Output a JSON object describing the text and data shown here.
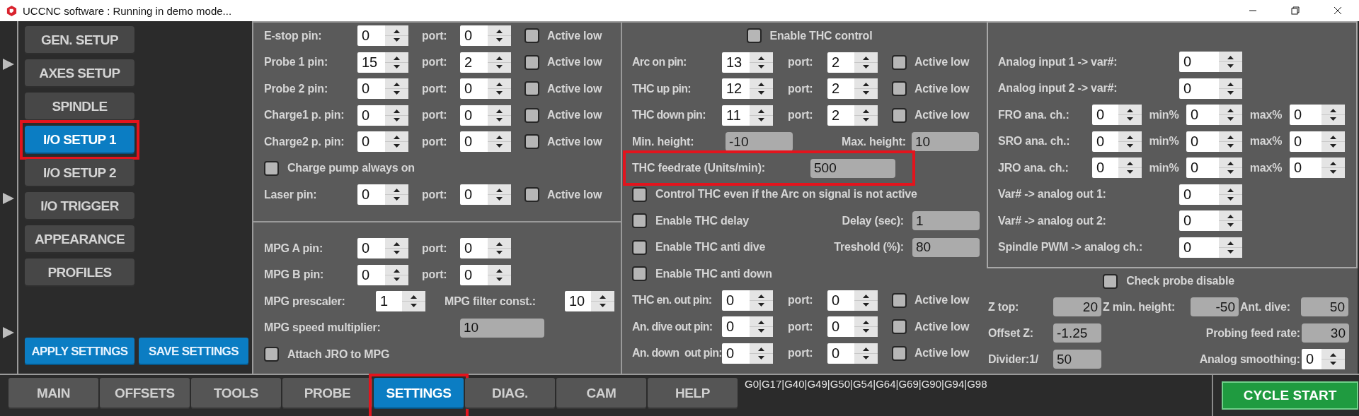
{
  "window": {
    "title": "UCCNC software : Running in demo mode..."
  },
  "sidebar": {
    "items": [
      {
        "label": "GEN. SETUP",
        "selected": false,
        "highlighted": false
      },
      {
        "label": "AXES SETUP",
        "selected": false,
        "highlighted": false
      },
      {
        "label": "SPINDLE",
        "selected": false,
        "highlighted": false
      },
      {
        "label": "I/O SETUP 1",
        "selected": true,
        "highlighted": true
      },
      {
        "label": "I/O SETUP 2",
        "selected": false,
        "highlighted": false
      },
      {
        "label": "I/O TRIGGER",
        "selected": false,
        "highlighted": false
      },
      {
        "label": "APPEARANCE",
        "selected": false,
        "highlighted": false
      },
      {
        "label": "PROFILES",
        "selected": false,
        "highlighted": false
      }
    ],
    "actions": [
      "APPLY SETTINGS",
      "SAVE SETTINGS"
    ]
  },
  "io_panel": {
    "rows": [
      {
        "kind": "pin",
        "label": "E-stop pin:",
        "pin": "0",
        "port_label": "port:",
        "port": "0",
        "option": "Active low",
        "checked": false
      },
      {
        "kind": "pin",
        "label": "Probe 1 pin:",
        "pin": "15",
        "port_label": "port:",
        "port": "2",
        "option": "Active low",
        "checked": false
      },
      {
        "kind": "pin",
        "label": "Probe 2 pin:",
        "pin": "0",
        "port_label": "port:",
        "port": "0",
        "option": "Active low",
        "checked": false
      },
      {
        "kind": "pin",
        "label": "Charge1 p. pin:",
        "pin": "0",
        "port_label": "port:",
        "port": "0",
        "option": "Active low",
        "checked": false
      },
      {
        "kind": "pin",
        "label": "Charge2 p. pin:",
        "pin": "0",
        "port_label": "port:",
        "port": "0",
        "option": "Active low",
        "checked": false
      },
      {
        "kind": "check",
        "label": "Charge pump always on",
        "checked": false
      },
      {
        "kind": "pin",
        "label": "Laser pin:",
        "pin": "0",
        "port_label": "port:",
        "port": "0",
        "option": "Active low",
        "checked": false
      }
    ]
  },
  "mpg_panel": {
    "rows": [
      {
        "kind": "pin",
        "label": "MPG A pin:",
        "pin": "0",
        "port_label": "port:",
        "port": "0"
      },
      {
        "kind": "pin",
        "label": "MPG B pin:",
        "pin": "0",
        "port_label": "port:",
        "port": "0"
      },
      {
        "kind": "spin_pair",
        "label": "MPG prescaler:",
        "value": "1",
        "label2": "MPG filter const.:",
        "value2": "10"
      },
      {
        "kind": "field",
        "label": "MPG speed multiplier:",
        "value": "10"
      },
      {
        "kind": "check",
        "label": "Attach JRO to MPG",
        "checked": false
      }
    ]
  },
  "thc_panel": {
    "rows": [
      {
        "kind": "header_check",
        "label": "Enable THC control",
        "checked": false
      },
      {
        "kind": "pin",
        "label": "Arc on pin:",
        "pin": "13",
        "port_label": "port:",
        "port": "2",
        "option": "Active low",
        "checked": false
      },
      {
        "kind": "pin",
        "label": "THC up pin:",
        "pin": "12",
        "port_label": "port:",
        "port": "2",
        "option": "Active low",
        "checked": false
      },
      {
        "kind": "pin",
        "label": "THC down pin:",
        "pin": "11",
        "port_label": "port:",
        "port": "2",
        "option": "Active low",
        "checked": false
      },
      {
        "kind": "field_pair",
        "label": "Min. height:",
        "value": "-10",
        "label2": "Max. height:",
        "value2": "10"
      },
      {
        "kind": "field",
        "label": "THC feedrate (Units/min):",
        "value": "500",
        "highlighted": true
      },
      {
        "kind": "check",
        "label": "Control THC even if the Arc on signal is not active",
        "checked": false
      },
      {
        "kind": "check_field",
        "label": "Enable THC delay",
        "checked": false,
        "label2": "Delay (sec):",
        "value2": "1"
      },
      {
        "kind": "check_field",
        "label": "Enable THC anti dive",
        "checked": false,
        "label2": "Treshold (%):",
        "value2": "80"
      },
      {
        "kind": "check",
        "label": "Enable THC anti down",
        "checked": false
      },
      {
        "kind": "pin",
        "label": "THC en. out pin:",
        "pin": "0",
        "port_label": "port:",
        "port": "0",
        "option": "Active low",
        "checked": false
      },
      {
        "kind": "pin",
        "label": "An. dive out pin:",
        "pin": "0",
        "port_label": "port:",
        "port": "0",
        "option": "Active low",
        "checked": false
      },
      {
        "kind": "pin",
        "label": "An. down  out pin:",
        "pin": "0",
        "port_label": "port:",
        "port": "0",
        "option": "Active low",
        "checked": false
      }
    ]
  },
  "analog_panel": {
    "rows": [
      {
        "kind": "spin",
        "label": "Analog input 1 -> var#:",
        "value": "0"
      },
      {
        "kind": "spin",
        "label": "Analog input 2 -> var#:",
        "value": "0"
      },
      {
        "kind": "channel",
        "label": "FRO ana. ch.:",
        "value": "0",
        "min_label": "min%",
        "min": "0",
        "max_label": "max%",
        "max": "0"
      },
      {
        "kind": "channel",
        "label": "SRO ana. ch.:",
        "value": "0",
        "min_label": "min%",
        "min": "0",
        "max_label": "max%",
        "max": "0"
      },
      {
        "kind": "channel",
        "label": "JRO ana. ch.:",
        "value": "0",
        "min_label": "min%",
        "min": "0",
        "max_label": "max%",
        "max": "0"
      },
      {
        "kind": "spin",
        "label": "Var# -> analog out 1:",
        "value": "0"
      },
      {
        "kind": "spin",
        "label": "Var# -> analog out 2:",
        "value": "0"
      },
      {
        "kind": "spin",
        "label": "Spindle PWM -> analog ch.:",
        "value": "0"
      }
    ]
  },
  "probe": {
    "check": {
      "label": "Check probe disable",
      "checked": false
    },
    "z_top": {
      "label": "Z top:",
      "value": "20"
    },
    "z_min_height": {
      "label": "Z min. height:",
      "value": "-50"
    },
    "ant_dive": {
      "label": "Ant. dive:",
      "value": "50"
    },
    "offset_z": {
      "label": "Offset Z:",
      "value": "-1.25"
    },
    "probing_feed_rate": {
      "label": "Probing feed rate:",
      "value": "30"
    },
    "divider": {
      "label": "Divider:1/",
      "value": "50"
    },
    "analog_smoothing": {
      "label": "Analog smoothing:",
      "value": "0"
    }
  },
  "tabs": [
    {
      "label": "MAIN",
      "selected": false,
      "highlighted": false
    },
    {
      "label": "OFFSETS",
      "selected": false,
      "highlighted": false
    },
    {
      "label": "TOOLS",
      "selected": false,
      "highlighted": false
    },
    {
      "label": "PROBE",
      "selected": false,
      "highlighted": false
    },
    {
      "label": "SETTINGS",
      "selected": true,
      "highlighted": true
    },
    {
      "label": "DIAG.",
      "selected": false,
      "highlighted": false
    },
    {
      "label": "CAM",
      "selected": false,
      "highlighted": false
    },
    {
      "label": "HELP",
      "selected": false,
      "highlighted": false
    }
  ],
  "gcode_status": "G0|G17|G40|G49|G50|G54|G64|G69|G90|G94|G98",
  "cycle_start": "CYCLE START"
}
